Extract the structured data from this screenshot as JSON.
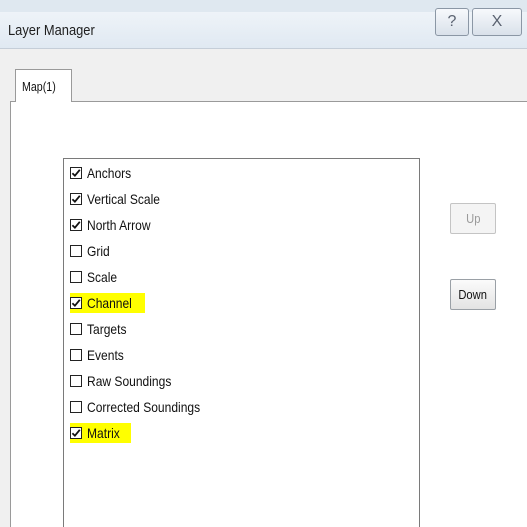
{
  "window": {
    "title": "Layer Manager",
    "help_glyph": "?",
    "close_glyph": "X"
  },
  "tabs": [
    {
      "label": "Map(1)",
      "selected": true
    }
  ],
  "layers": [
    {
      "label": "Anchors",
      "checked": true,
      "highlighted": false
    },
    {
      "label": "Vertical Scale",
      "checked": true,
      "highlighted": false
    },
    {
      "label": "North Arrow",
      "checked": true,
      "highlighted": false
    },
    {
      "label": "Grid",
      "checked": false,
      "highlighted": false
    },
    {
      "label": "Scale",
      "checked": false,
      "highlighted": false
    },
    {
      "label": "Channel",
      "checked": true,
      "highlighted": true
    },
    {
      "label": "Targets",
      "checked": false,
      "highlighted": false
    },
    {
      "label": "Events",
      "checked": false,
      "highlighted": false
    },
    {
      "label": "Raw Soundings",
      "checked": false,
      "highlighted": false
    },
    {
      "label": "Corrected Soundings",
      "checked": false,
      "highlighted": false
    },
    {
      "label": "Matrix",
      "checked": true,
      "highlighted": true
    }
  ],
  "buttons": {
    "up_label": "Up",
    "up_enabled": false,
    "down_label": "Down",
    "down_enabled": true
  },
  "colors": {
    "highlight": "#ffff00",
    "disabled_text": "#9a9a9a"
  }
}
